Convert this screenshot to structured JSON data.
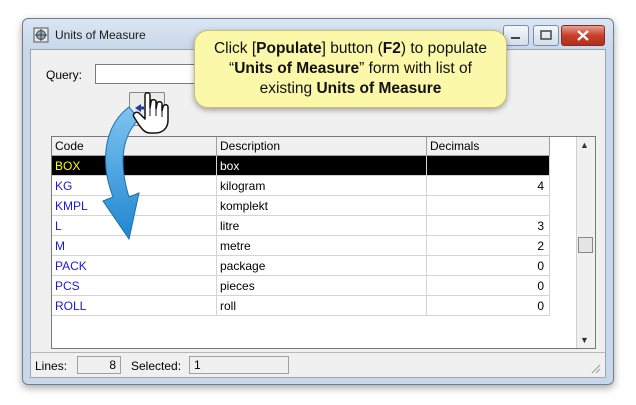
{
  "window": {
    "title": "Units of Measure",
    "icon": "units-icon"
  },
  "query": {
    "label": "Query:",
    "value": "",
    "placeholder": ""
  },
  "toolbar": {
    "populate_icon": "populate-icon"
  },
  "callout": {
    "text_1": "Click [",
    "text_2": "Populate",
    "text_3": "] button (",
    "text_4": "F2",
    "text_5": ") to populate",
    "text_6": "“",
    "text_7": "Units of Measure",
    "text_8": "” form with list of",
    "text_9": "existing ",
    "text_10": "Units of Measure"
  },
  "grid": {
    "columns": [
      "Code",
      "Description",
      "Decimals"
    ],
    "rows": [
      {
        "code": "BOX",
        "description": "box",
        "decimals": ""
      },
      {
        "code": "KG",
        "description": "kilogram",
        "decimals": "4"
      },
      {
        "code": "KMPL",
        "description": "komplekt",
        "decimals": ""
      },
      {
        "code": "L",
        "description": "litre",
        "decimals": "3"
      },
      {
        "code": "M",
        "description": "metre",
        "decimals": "2"
      },
      {
        "code": "PACK",
        "description": "package",
        "decimals": "0"
      },
      {
        "code": "PCS",
        "description": "pieces",
        "decimals": "0"
      },
      {
        "code": "ROLL",
        "description": "roll",
        "decimals": "0"
      }
    ]
  },
  "status": {
    "lines_label": "Lines:",
    "lines_value": "8",
    "selected_label": "Selected:",
    "selected_value": "1"
  },
  "colors": {
    "selected_row_bg": "#000000",
    "selected_code_text": "#ffff00",
    "code_text": "#1a1ad0",
    "callout_bg": "#fbf9a9",
    "arrow_blue": "#3a9fe0"
  }
}
